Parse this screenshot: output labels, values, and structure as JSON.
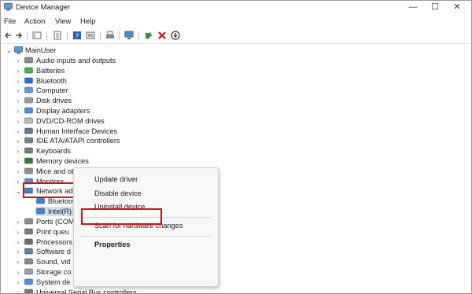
{
  "window": {
    "title": "Device Manager",
    "controls": {
      "minimize": "—",
      "maximize": "☐",
      "close": "✕"
    }
  },
  "menu": [
    "File",
    "Action",
    "View",
    "Help"
  ],
  "tree": {
    "root": "MainUser",
    "categories": [
      {
        "label": "Audio inputs and outputs",
        "icon": "speaker-icon"
      },
      {
        "label": "Batteries",
        "icon": "battery-icon"
      },
      {
        "label": "Bluetooth",
        "icon": "bluetooth-icon"
      },
      {
        "label": "Computer",
        "icon": "computer-icon"
      },
      {
        "label": "Disk drives",
        "icon": "disk-icon"
      },
      {
        "label": "Display adapters",
        "icon": "display-icon"
      },
      {
        "label": "DVD/CD-ROM drives",
        "icon": "dvd-icon"
      },
      {
        "label": "Human Interface Devices",
        "icon": "hid-icon"
      },
      {
        "label": "IDE ATA/ATAPI controllers",
        "icon": "ide-icon"
      },
      {
        "label": "Keyboards",
        "icon": "keyboard-icon"
      },
      {
        "label": "Memory devices",
        "icon": "memory-icon"
      },
      {
        "label": "Mice and other pointing devices",
        "icon": "mouse-icon"
      },
      {
        "label": "Monitors",
        "icon": "monitor-icon"
      },
      {
        "label": "Network adapters",
        "icon": "network-icon"
      }
    ],
    "network_children": [
      "Bluetooth Device (Personal Area Network)",
      "Intel(R)"
    ],
    "after_categories": [
      {
        "label": "Ports (COM",
        "icon": "port-icon"
      },
      {
        "label": "Print queu",
        "icon": "printer-icon"
      },
      {
        "label": "Processors",
        "icon": "cpu-icon"
      },
      {
        "label": "Software d",
        "icon": "software-icon"
      },
      {
        "label": "Sound, vid",
        "icon": "sound-icon"
      },
      {
        "label": "Storage co",
        "icon": "storage-icon"
      },
      {
        "label": "System de",
        "icon": "system-icon"
      },
      {
        "label": "Universal Serial Bus controllers",
        "icon": "usb-icon"
      }
    ]
  },
  "context_menu": {
    "update": "Update driver",
    "disable": "Disable device",
    "uninstall": "Uninstall device",
    "scan": "Scan for hardware changes",
    "properties": "Properties"
  },
  "colors": {
    "highlight": "#d0121b",
    "selection": "#cfe0f2"
  }
}
